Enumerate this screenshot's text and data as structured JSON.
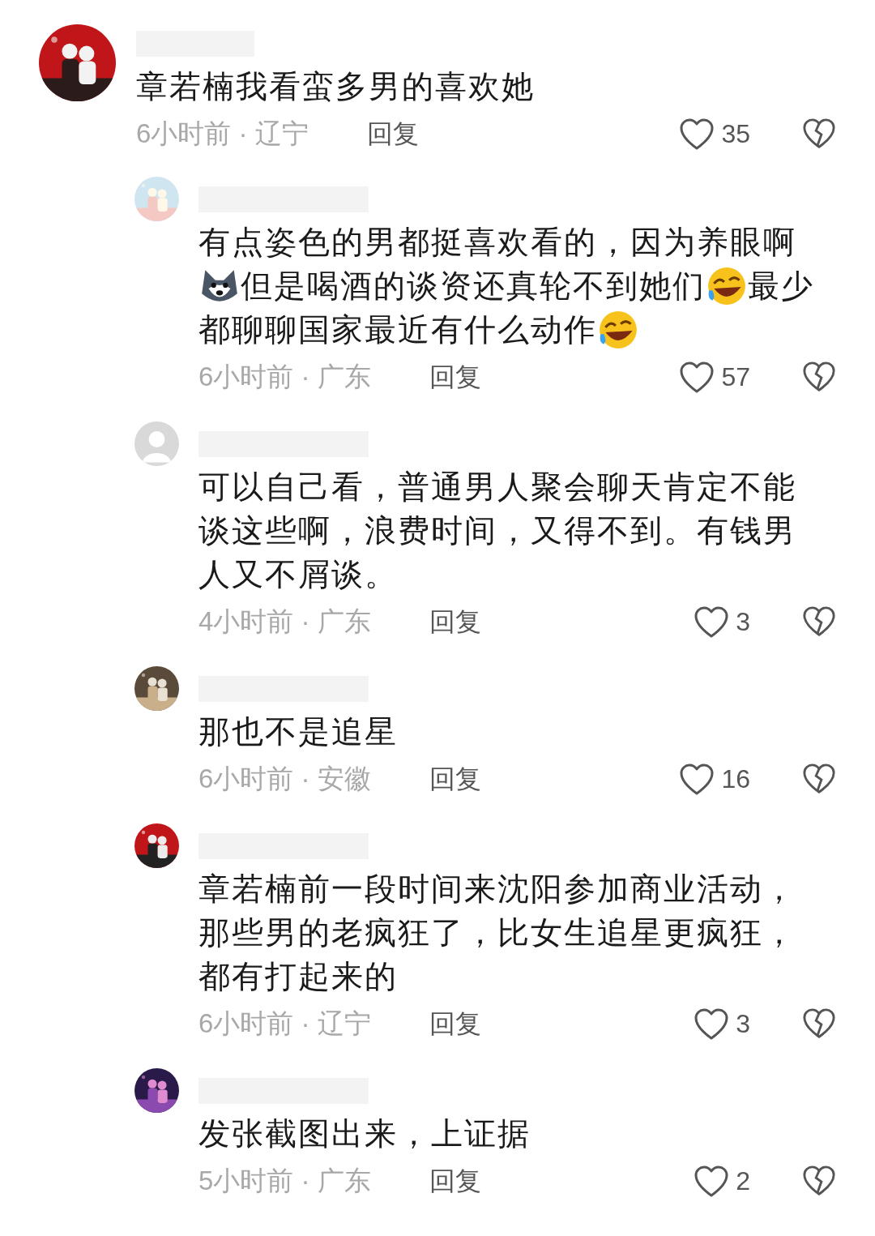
{
  "comments": [
    {
      "avatar": {
        "kind": "picture"
      },
      "content": [
        [
          {
            "kind": "text",
            "text": "章若楠我看蛮多男的喜欢她"
          }
        ]
      ],
      "time_location": "6小时前 · 辽宁",
      "reply_label": "回复",
      "likes": "35",
      "replies": [
        {
          "avatar": {
            "kind": "picture"
          },
          "content": [
            [
              {
                "kind": "text",
                "text": "有点姿色的男都挺喜欢看的，因为养眼啊"
              }
            ],
            [
              {
                "kind": "dog"
              },
              {
                "kind": "text",
                "text": "但是喝酒的谈资还真轮不到她们"
              },
              {
                "kind": "laugh"
              },
              {
                "kind": "text",
                "text": "最少"
              }
            ],
            [
              {
                "kind": "text",
                "text": "都聊聊国家最近有什么动作"
              },
              {
                "kind": "laugh"
              }
            ]
          ],
          "time_location": "6小时前 · 广东",
          "reply_label": "回复",
          "likes": "57"
        },
        {
          "avatar": {
            "kind": "default"
          },
          "content": [
            [
              {
                "kind": "text",
                "text": "可以自己看，普通男人聚会聊天肯定不能谈这些啊，浪费时间，又得不到。有钱男人又不屑谈。"
              }
            ]
          ],
          "time_location": "4小时前 · 广东",
          "reply_label": "回复",
          "likes": "3"
        },
        {
          "avatar": {
            "kind": "picture"
          },
          "content": [
            [
              {
                "kind": "text",
                "text": "那也不是追星"
              }
            ]
          ],
          "time_location": "6小时前 · 安徽",
          "reply_label": "回复",
          "likes": "16"
        },
        {
          "avatar": {
            "kind": "picture"
          },
          "content": [
            [
              {
                "kind": "text",
                "text": "章若楠前一段时间来沈阳参加商业活动，那些男的老疯狂了，比女生追星更疯狂，都有打起来的"
              }
            ]
          ],
          "time_location": "6小时前 · 辽宁",
          "reply_label": "回复",
          "likes": "3"
        },
        {
          "avatar": {
            "kind": "picture"
          },
          "content": [
            [
              {
                "kind": "text",
                "text": "发张截图出来，上证据"
              }
            ]
          ],
          "time_location": "5小时前 · 广东",
          "reply_label": "回复",
          "likes": "2"
        }
      ]
    }
  ]
}
